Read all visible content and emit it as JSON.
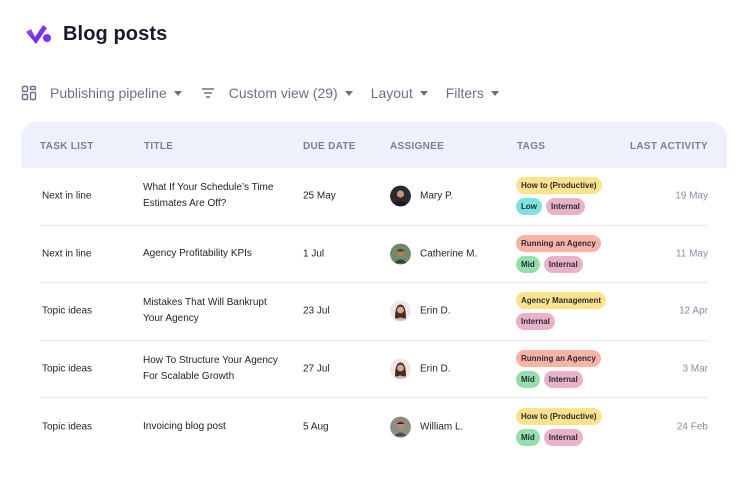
{
  "header": {
    "title": "Blog posts"
  },
  "toolbar": {
    "pipeline_label": "Publishing pipeline",
    "view_label": "Custom view (29)",
    "layout_label": "Layout",
    "filters_label": "Filters"
  },
  "table": {
    "columns": [
      "TASK LIST",
      "TITLE",
      "DUE DATE",
      "ASSIGNEE",
      "TAGS",
      "LAST ACTIVITY"
    ],
    "rows": [
      {
        "task": "Next in line",
        "title": "What If Your Schedule’s Time Estimates Are Off?",
        "due": "25 May",
        "assignee": "Mary P.",
        "activity": "19 May"
      },
      {
        "task": "Next in line",
        "title": "Agency Profitability KPIs",
        "due": "1 Jul",
        "assignee": "Catherine M.",
        "activity": "11 May"
      },
      {
        "task": "Topic ideas",
        "title": "Mistakes That Will Bankrupt Your Agency",
        "due": "23 Jul",
        "assignee": "Erin D.",
        "activity": "12 Apr"
      },
      {
        "task": "Topic ideas",
        "title": "How To Structure Your Agency For Scalable Growth",
        "due": "27 Jul",
        "assignee": "Erin D.",
        "activity": "3 Mar"
      },
      {
        "task": "Topic ideas",
        "title": "Invoicing blog post",
        "due": "5 Aug",
        "assignee": "William L.",
        "activity": "24 Feb"
      }
    ],
    "tags": [
      [
        [
          "How to (Productive)"
        ],
        [
          "Low",
          "Internal"
        ]
      ],
      [
        [
          "Running an Agency"
        ],
        [
          "Mid",
          "Internal"
        ]
      ],
      [
        [
          "Agency Management"
        ],
        [
          "Internal"
        ]
      ],
      [
        [
          "Running an Agency"
        ],
        [
          "Mid",
          "Internal"
        ]
      ],
      [
        [
          "How to (Productive)"
        ],
        [
          "Mid",
          "Internal"
        ]
      ]
    ]
  },
  "colors": {
    "brand": "#7b2ff7",
    "header_bg": "#eef1fb",
    "tag_yellow": "#fbe38b",
    "tag_salmon": "#f8b3a3",
    "tag_pink": "#e9b2c9",
    "tag_cyan": "#7de3e0",
    "tag_green": "#93e0ad"
  }
}
